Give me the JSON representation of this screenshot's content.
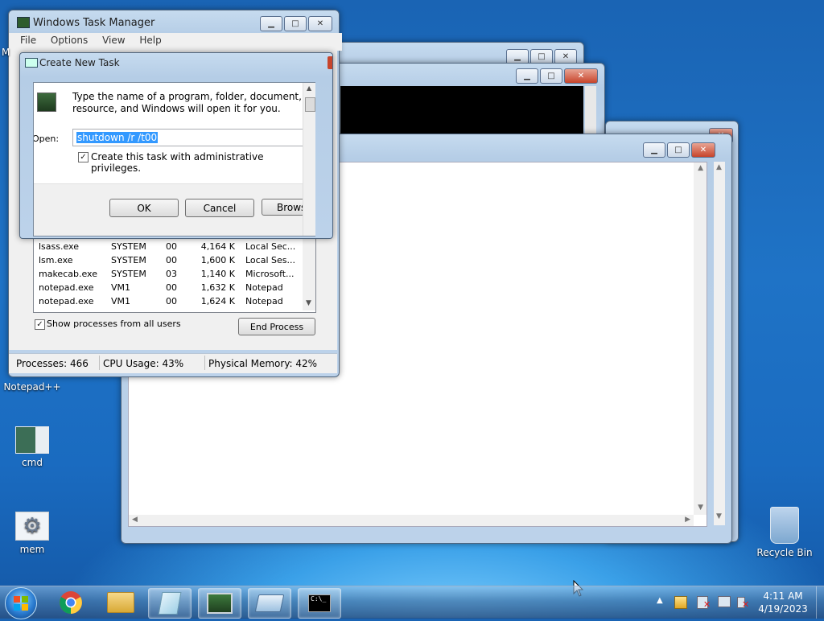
{
  "task_manager": {
    "title": "Windows Task Manager",
    "menu": [
      "File",
      "Options",
      "View",
      "Help"
    ],
    "processes": [
      {
        "name": "lsass.exe",
        "user": "SYSTEM",
        "cpu": "00",
        "mem": "4,164 K",
        "desc": "Local Sec..."
      },
      {
        "name": "lsm.exe",
        "user": "SYSTEM",
        "cpu": "00",
        "mem": "1,600 K",
        "desc": "Local Ses..."
      },
      {
        "name": "makecab.exe",
        "user": "SYSTEM",
        "cpu": "03",
        "mem": "1,140 K",
        "desc": "Microsoft..."
      },
      {
        "name": "notepad.exe",
        "user": "VM1",
        "cpu": "00",
        "mem": "1,632 K",
        "desc": "Notepad"
      },
      {
        "name": "notepad.exe",
        "user": "VM1",
        "cpu": "00",
        "mem": "1,624 K",
        "desc": "Notepad"
      }
    ],
    "show_all_label": "Show processes from all users",
    "end_process_label": "End Process",
    "status": {
      "processes": "Processes: 466",
      "cpu": "CPU Usage: 43%",
      "memory": "Physical Memory: 42%"
    }
  },
  "create_task": {
    "title": "Create New Task",
    "description": "Type the name of a program, folder, document, or Internet resource, and Windows will open it for you.",
    "description_line1": "Type the name of a program, folder, document, or Inte",
    "description_line2": "resource, and Windows will open it for you.",
    "open_label": "Open:",
    "open_value": "shutdown /r /t00",
    "admin_label": "Create this task with administrative privileges.",
    "ok_label": "OK",
    "cancel_label": "Cancel",
    "browse_label": "Brows"
  },
  "desktop_icons": [
    {
      "label": "Notepad++"
    },
    {
      "label": "cmd"
    },
    {
      "label": "mem"
    },
    {
      "label": "Recycle Bin"
    }
  ],
  "desktop_partial_label": "M",
  "clock": {
    "time": "4:11 AM",
    "date": "4/19/2023"
  },
  "colors": {
    "selection": "#3399ff",
    "close": "#c7442b"
  }
}
